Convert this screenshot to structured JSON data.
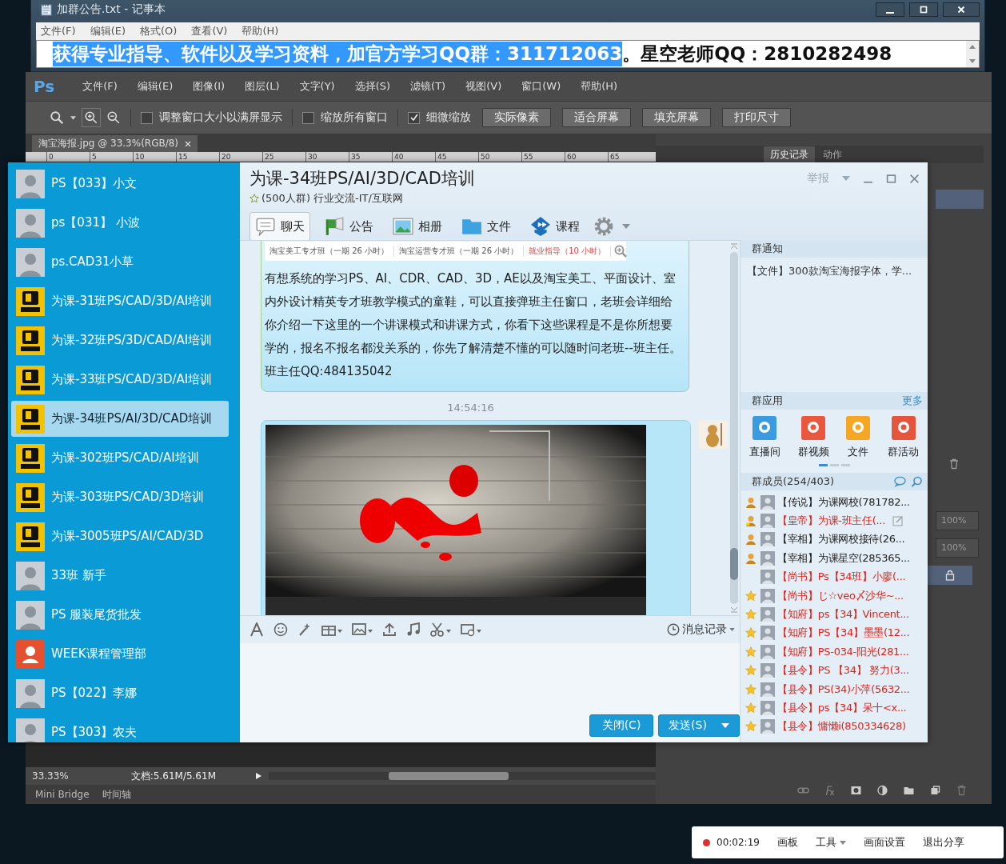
{
  "notepad": {
    "title": "加群公告.txt - 记事本",
    "menu": [
      "文件(F)",
      "编辑(E)",
      "格式(O)",
      "查看(V)",
      "帮助(H)"
    ],
    "text": [
      {
        "text": "获得专业指导、软件以及学习资料，加官方学习QQ群：311712063",
        "selected": true
      },
      {
        "text": "。星空老师QQ：2810282498",
        "selected": false
      }
    ]
  },
  "photoshop": {
    "logo": "Ps",
    "menu": [
      "文件(F)",
      "编辑(E)",
      "图像(I)",
      "图层(L)",
      "文字(Y)",
      "选择(S)",
      "滤镜(T)",
      "视图(V)",
      "窗口(W)",
      "帮助(H)"
    ],
    "checkboxes": [
      {
        "label": "调整窗口大小以满屏显示",
        "checked": false
      },
      {
        "label": "缩放所有窗口",
        "checked": false
      },
      {
        "label": "细微缩放",
        "checked": true
      }
    ],
    "buttons": [
      "实际像素",
      "适合屏幕",
      "填充屏幕",
      "打印尺寸"
    ],
    "document_tab": "淘宝海报.jpg @ 33.3%(RGB/8)",
    "ruler": [
      "0",
      "5",
      "10",
      "15",
      "20",
      "25",
      "30",
      "35",
      "40",
      "45",
      "50",
      "55",
      "60",
      "65"
    ],
    "panel_tabs": [
      {
        "label": "历史记录",
        "selected": true
      },
      {
        "label": "动作",
        "selected": false
      }
    ],
    "opacity_fields": [
      "100%",
      "100%"
    ],
    "status": {
      "zoom": "33.33%",
      "document": "文档:5.61M/5.61M"
    },
    "bottom_tabs": [
      "Mini Bridge",
      "时间轴"
    ]
  },
  "chat": {
    "title": "为课-34班PS/AI/3D/CAD培训",
    "subtitle": "(500人群) 行业交流-IT/互联网",
    "report": "举报",
    "tabs": [
      {
        "label": "聊天",
        "kind": "chat",
        "selected": true
      },
      {
        "label": "公告",
        "kind": "flag",
        "selected": false
      },
      {
        "label": "相册",
        "selected": false
      },
      {
        "label": "文件",
        "kind": "folder",
        "selected": false
      },
      {
        "label": "课程",
        "kind": "course",
        "selected": false
      }
    ],
    "contacts": [
      {
        "name": "PS【033】小文",
        "selected": false
      },
      {
        "name": "ps【031】 小波",
        "selected": false
      },
      {
        "name": "ps.CAD31小草",
        "selected": false
      },
      {
        "name": "为课-31班PS/CAD/3D/AI培训",
        "kind": "logo",
        "selected": false
      },
      {
        "name": "为课-32班PS/3D/CAD/AI培训",
        "kind": "logo",
        "selected": false
      },
      {
        "name": "为课-33班PS/CAD/3D/AI培训",
        "kind": "logo",
        "selected": false
      },
      {
        "name": "为课-34班PS/AI/3D/CAD培训",
        "kind": "logo",
        "selected": true
      },
      {
        "name": "为课-302班PS/CAD/AI培训",
        "kind": "logo",
        "selected": false
      },
      {
        "name": "为课-303班PS/CAD/3D培训",
        "kind": "logo",
        "selected": false
      },
      {
        "name": "为课-3005班PS/AI/CAD/3D",
        "kind": "logo",
        "selected": false
      },
      {
        "name": "33班 新手",
        "selected": false
      },
      {
        "name": "PS 服装尾货批发",
        "selected": false
      },
      {
        "name": "WEEK课程管理部",
        "kind": "user",
        "selected": false
      },
      {
        "name": "PS【022】李娜",
        "selected": false
      },
      {
        "name": "PS【303】农夫",
        "selected": false
      }
    ],
    "messages": [
      {
        "kind": "text",
        "table": [
          "淘宝美工专才班（一期 26 小时）",
          "淘宝运营专才班（一期 26 小时）",
          "就业指导（10 小时）"
        ],
        "text": "有想系统的学习PS、AI、CDR、CAD、3D，AE以及淘宝美工、平面设计、室内外设计精英专才班教学模式的童鞋，可以直接弹班主任窗口，老班会详细给你介绍一下这里的一个讲课模式和讲课方式，你看下这些课程是不是你所想要学的，报名不报名都没关系的，你先了解清楚不懂的可以随时问老班--班主任。班主任QQ:484135042"
      },
      {
        "kind": "time",
        "text": "14:54:16"
      },
      {
        "kind": "picture"
      }
    ],
    "history": "消息记录",
    "close_button": "关闭(C)",
    "send_button": "发送(S)",
    "notice": {
      "title": "群通知",
      "text": "【文件】300款淘宝海报字体，学..."
    },
    "apps": {
      "title": "群应用",
      "more": "更多",
      "items": [
        {
          "label": "直播间",
          "color": "#3a9be0"
        },
        {
          "label": "群视频",
          "color": "#e8583e"
        },
        {
          "label": "文件",
          "color": "#f5a623"
        },
        {
          "label": "群活动",
          "color": "#e4553b"
        }
      ]
    },
    "members": {
      "title": "群成员(254/403)",
      "items": [
        {
          "text": "【传说】为课网校(781782...",
          "kind": "admin",
          "color": "#222222",
          "hovered": false
        },
        {
          "text": "【皇帝】为课-班主任(...",
          "kind": "owner",
          "color": "#d9261c",
          "hovered": true
        },
        {
          "text": "【宰相】为课网校接待(26...",
          "kind": "admin",
          "color": "#222222",
          "hovered": false
        },
        {
          "text": "【宰相】为课星空(285365...",
          "kind": "admin",
          "color": "#222222",
          "hovered": false
        },
        {
          "text": "【尚书】Ps【34班】小廖(...",
          "kind": "none",
          "color": "#d9261c",
          "hovered": false
        },
        {
          "text": "【尚书】じ☆veo〆沙华~...",
          "kind": "star",
          "color": "#d9261c",
          "hovered": false
        },
        {
          "text": "【知府】ps【34】Vincent...",
          "kind": "star",
          "color": "#d9261c",
          "hovered": false
        },
        {
          "text": "【知府】PS【34】墨墨(12...",
          "kind": "star",
          "color": "#d9261c",
          "hovered": false
        },
        {
          "text": "【知府】PS-034-阳光(281...",
          "kind": "star",
          "color": "#d9261c",
          "hovered": false
        },
        {
          "text": "【县令】PS 【34】 努力(3...",
          "kind": "star",
          "color": "#d9261c",
          "hovered": false
        },
        {
          "text": "【县令】PS(34)小萍(5632...",
          "kind": "star",
          "color": "#d9261c",
          "hovered": false
        },
        {
          "text": "【县令】ps【34】呆十<x...",
          "kind": "star",
          "color": "#d9261c",
          "hovered": false
        },
        {
          "text": "【县令】慵懒i(850334628)",
          "kind": "star",
          "color": "#d9261c",
          "hovered": false
        }
      ]
    }
  },
  "recorder": {
    "time": "00:02:19",
    "items": [
      {
        "label": "画板",
        "menu": false
      },
      {
        "label": "工具",
        "menu": true
      },
      {
        "label": "画面设置",
        "menu": false
      },
      {
        "label": "退出分享",
        "menu": false
      }
    ]
  }
}
